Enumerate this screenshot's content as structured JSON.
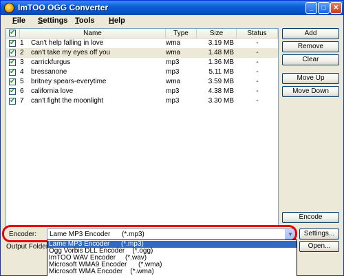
{
  "window": {
    "title": "ImTOO OGG Converter"
  },
  "titlebar_buttons": {
    "minimize": "_",
    "maximize": "□",
    "close": "✕"
  },
  "menu": [
    "File",
    "Settings",
    "Tools",
    "Help"
  ],
  "menu_underline_first": [
    "F",
    "S",
    "T",
    "H"
  ],
  "menu_rest": [
    "ile",
    "ettings",
    "ools",
    "elp"
  ],
  "list": {
    "columns": {
      "name": "Name",
      "type": "Type",
      "size": "Size",
      "status": "Status"
    },
    "rows": [
      {
        "num": "1",
        "name": "Can't help falling in love",
        "type": "wma",
        "size": "3.19 MB",
        "status": "-",
        "checked": true,
        "selected": false
      },
      {
        "num": "2",
        "name": "can't take my eyes off you",
        "type": "wma",
        "size": "1.48 MB",
        "status": "-",
        "checked": true,
        "selected": true
      },
      {
        "num": "3",
        "name": "carrickfurgus",
        "type": "mp3",
        "size": "1.36 MB",
        "status": "-",
        "checked": true,
        "selected": false
      },
      {
        "num": "4",
        "name": "bressanone",
        "type": "mp3",
        "size": "5.11 MB",
        "status": "-",
        "checked": true,
        "selected": false
      },
      {
        "num": "5",
        "name": "britney spears-everytime",
        "type": "wma",
        "size": "3.59 MB",
        "status": "-",
        "checked": true,
        "selected": false
      },
      {
        "num": "6",
        "name": "california love",
        "type": "mp3",
        "size": "4.38 MB",
        "status": "-",
        "checked": true,
        "selected": false
      },
      {
        "num": "7",
        "name": "can't fight the moonlight",
        "type": "mp3",
        "size": "3.30 MB",
        "status": "-",
        "checked": true,
        "selected": false
      }
    ]
  },
  "buttons": {
    "add": "Add",
    "remove": "Remove",
    "clear": "Clear",
    "move_up": "Move Up",
    "move_down": "Move Down",
    "encode": "Encode",
    "settings": "Settings...",
    "open": "Open..."
  },
  "encoder": {
    "label": "Encoder:",
    "selected": "Lame MP3 Encoder      (*.mp3)",
    "options": [
      "Lame MP3 Encoder      (*.mp3)",
      "Ogg Vorbis DLL Encoder    (*.ogg)",
      "ImTOO WAV Encoder     (*.wav)",
      "Microsoft WMA9 Encoder      (*.wma)",
      "Microsoft WMA Encoder    (*.wma)"
    ]
  },
  "output": {
    "label": "Output Folder:"
  },
  "colors": {
    "highlight_ring": "#e60000",
    "dropdown_selection": "#316ac5",
    "titlebar": "#0a5fd8"
  }
}
